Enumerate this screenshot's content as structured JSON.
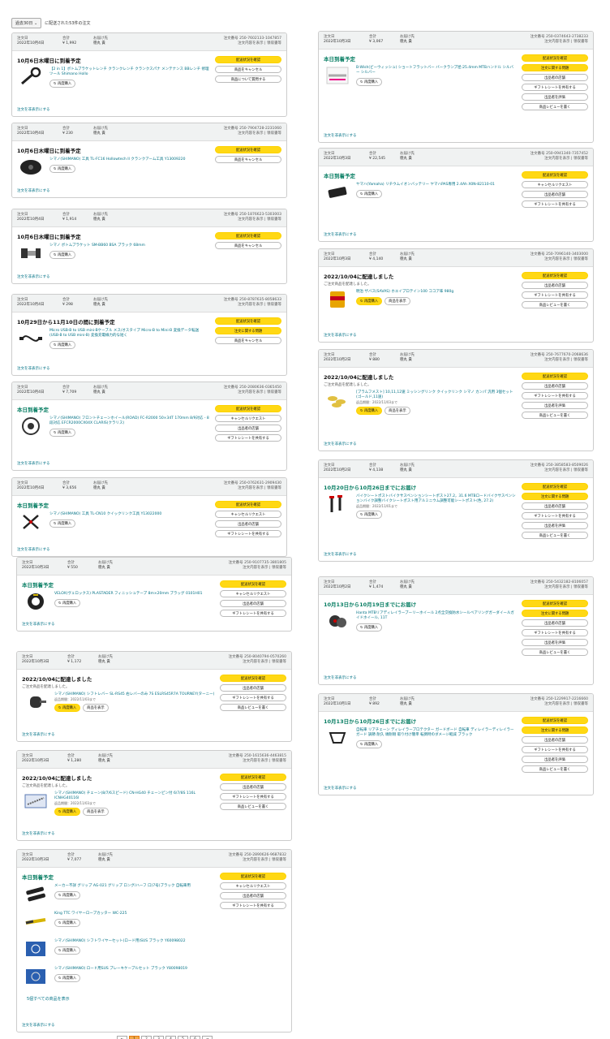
{
  "filter": {
    "selected": "過去30日",
    "summary": "に配送された53件の注文"
  },
  "labels": {
    "order_date": "注文日",
    "total": "合計",
    "ship_to": "お届け先",
    "order_no_prefix": "注文番号",
    "details": "注文内容を表示",
    "receipt": "領収書等",
    "hide": "注文を非表示にする",
    "rebuy": "再度購入",
    "view_item": "商品を表示",
    "show_all": "5個すべての商品を表示"
  },
  "orders": [
    {
      "date": "2022年10月4日",
      "total": "¥ 1,992",
      "to": "徳丸 貴",
      "no": "250-7602133-1047857",
      "status": "10月6日木曜日に到着予定",
      "sub": "",
      "items": [
        {
          "name": "【2 in 1】ボトムブラケットレンチ クランクレンチ クランクスパナ メンテナンス BBレンチ 修理ツール Shimano Hollo",
          "icon": "wrench-icon",
          "view": false
        }
      ],
      "actions": [
        "配送状況を確認",
        "商品をキャンセル",
        "商品について質問する"
      ]
    },
    {
      "date": "2022年10月4日",
      "total": "¥ 230",
      "to": "徳丸 貴",
      "no": "250-7904728-2231060",
      "status": "10月6日木曜日に到着予定",
      "sub": "",
      "items": [
        {
          "name": "シマノ(SHIMANO) 工具 TL-FC16 Hollowtech II クランクアーム工具 Y13009220",
          "icon": "crank-tool-icon",
          "view": false
        }
      ],
      "actions": [
        "配送状況を確認",
        "商品をキャンセル"
      ]
    },
    {
      "date": "2022年10月4日",
      "total": "¥ 1,914",
      "to": "徳丸 貴",
      "no": "250-1876623-5303003",
      "status": "10月6日木曜日に到着予定",
      "sub": "",
      "items": [
        {
          "name": "シマノ ボトムブラケット SM-BB60 BSA ブラック 68mm",
          "icon": "bottom-bracket-icon",
          "view": false
        }
      ],
      "actions": [
        "配送状況を確認",
        "商品をキャンセル"
      ]
    },
    {
      "date": "2022年10月4日",
      "total": "¥ 298",
      "to": "徳丸 貴",
      "no": "250-8787635-8058633",
      "status": "10月29日から11月10日の間に到着予定",
      "sub": "",
      "items": [
        {
          "name": "Micro USB-B to USB mini-Bケーブル メス/オスタイプ Micro-B to Mini-B 変換データ転送 (USB-B to USB mini-B) 変換充電線力的な短く",
          "icon": "cable-icon",
          "view": false
        }
      ],
      "actions": [
        "配送状況を確認",
        "注文に関する問題",
        "商品をキャンセル"
      ]
    },
    {
      "date": "2022年10月4日",
      "total": "¥ 7,709",
      "to": "徳丸 貴",
      "no": "250-2080636-0365450",
      "status": "本日到着予定",
      "green": true,
      "sub": "",
      "items": [
        {
          "name": "シマノ(SHIMANO) フロントチェーンホイール(ROAD) FC-R2000 50×34T 170mm 8/9対応 - 8段対応 EFCR2000CX04X CLARIS(クラリス)",
          "icon": "chainring-icon",
          "view": false
        }
      ],
      "actions": [
        "配送状況を確認",
        "キャンセルリクエスト",
        "出品者の店舗",
        "ギフトレシートを共有する"
      ]
    },
    {
      "date": "2022年10月4日",
      "total": "¥ 3,656",
      "to": "徳丸 貴",
      "no": "250-0762631-2909430",
      "status": "本日到着予定",
      "green": true,
      "sub": "",
      "items": [
        {
          "name": "シマノ(SHIMANO) 工具 TL-CN10 クイックリンク工具 Y13022000",
          "icon": "pliers-icon",
          "view": false
        }
      ],
      "actions": [
        "配送状況を確認",
        "キャンセルリクエスト",
        "出品者の店舗",
        "ギフトレシートを共有する"
      ]
    },
    {
      "date": "2022年10月3日",
      "total": "¥ 550",
      "to": "徳丸 貴",
      "no": "250-9107735-3801805",
      "status": "本日到着予定",
      "green": true,
      "sub": "",
      "items": [
        {
          "name": "VELOX(ヴェロックス) PLASTADER フィニッシュテープ 8m×20mm ブラッグ 0101H01",
          "icon": "tape-icon",
          "view": false
        }
      ],
      "actions": [
        "配送状況を確認",
        "キャンセルリクエスト",
        "出品者の店舗",
        "ギフトレシートを共有する"
      ]
    },
    {
      "date": "2022年10月3日",
      "total": "¥ 1,172",
      "to": "徳丸 貴",
      "no": "250-8040794-0570260",
      "status": "2022/10/04に配達しました",
      "sub": "ご注文商品を配達しました。",
      "items": [
        {
          "name": "シマノ(SHIMANO) シフトレバー SL-RS45 右レバーのみ 7S ESLRS45R7A TOURNEY(ターニー)",
          "icon": "shift-lever-icon",
          "view": true,
          "note": "返品期間：2022/11/03まで"
        }
      ],
      "actions": [
        "配送状況を確認",
        "出品者の店舗",
        "ギフトレシートを共有する",
        "商品レビューを書く"
      ]
    },
    {
      "date": "2022年10月3日",
      "total": "¥ 1,280",
      "to": "徳丸 貴",
      "no": "250-1615636-4463815",
      "status": "2022/10/04に配達しました",
      "sub": "ご注文商品を配達しました。",
      "items": [
        {
          "name": "シマノ(SHIMANO) チェーン(8/7/6スピード) CN-HG40 チェーンピン付 6/7/8S 116L ICNHG40116I",
          "icon": "chain-icon",
          "view": true,
          "note": "返品期間：2022/11/03まで"
        }
      ],
      "actions": [
        "配送状況を確認",
        "出品者の店舗",
        "ギフトレシートを共有する",
        "商品レビューを書く"
      ]
    },
    {
      "date": "2022年10月3日",
      "total": "¥ 7,077",
      "to": "徳丸 貴",
      "no": "250-2890626-9687832",
      "status": "本日到着予定",
      "green": true,
      "sub": "",
      "items": [
        {
          "name": "メーカー不詳 グリップ AG-021 グリップ ロング/ハーフ 口(7号)ブラック 自転車用",
          "icon": "grip-icon",
          "view": false
        },
        {
          "name": "King TTC ワイヤーロープカッター WC-225",
          "icon": "cutter-icon",
          "view": false
        },
        {
          "name": "シマノ(SHIMANO) シフトワイヤーセット(ロード用)SUS ブラック Y60098022",
          "icon": "cable-set-icon",
          "view": false
        },
        {
          "name": "シマノ(SHIMANO) ロード用SUS ブレーキケーブルセット ブラック Y80098019",
          "icon": "brake-cable-icon",
          "view": false
        }
      ],
      "more": true,
      "actions": [
        "配送状況を確認",
        "キャンセルリクエスト",
        "出品者の店舗",
        "ギフトレシートを共有する"
      ]
    },
    {
      "date": "2022年10月3日",
      "total": "¥ 3,067",
      "to": "徳丸 貴",
      "no": "250-0374643-2738233",
      "status": "本日到着予定",
      "green": true,
      "sub": "",
      "items": [
        {
          "name": "B-Wish(ビーウィッシュ) ショートフラットバー バークランプ径:25.4mm MTBハンドル シルバー シルバー",
          "icon": "bar-icon",
          "view": false
        }
      ],
      "actions": [
        "配送状況を確認",
        "注文に関する問題",
        "出品者の店舗",
        "ギフトレシートを共有する",
        "出品者を評価",
        "商品レビューを書く"
      ]
    },
    {
      "date": "2022年10月3日",
      "total": "¥ 22,545",
      "to": "徳丸 貴",
      "no": "250-0941340-7357452",
      "status": "本日到着予定",
      "green": true,
      "sub": "",
      "items": [
        {
          "name": "ヤマハ(Yamaha) リチウムイオンバッテリー ヤマハPAS専用 2.4Ah X0N-82110-01",
          "icon": "battery-icon",
          "view": false
        }
      ],
      "actions": [
        "配送状況を確認",
        "キャンセルリクエスト",
        "出品者の店舗",
        "ギフトレシートを共有する"
      ]
    },
    {
      "date": "2022年10月3日",
      "total": "¥ 4,140",
      "to": "徳丸 貴",
      "no": "250-7096140-3403000",
      "status": "2022/10/04に配達しました",
      "sub": "ご注文商品を配達しました。",
      "items": [
        {
          "name": "明治 ザバス(SAVAS) ホエイプロテイン100 ココア味 980g",
          "icon": "protein-icon",
          "view": true
        }
      ],
      "actions": [
        "配送状況を確認",
        "出品者の店舗",
        "ギフトレシートを共有する",
        "商品レビューを書く"
      ]
    },
    {
      "date": "2022年10月2日",
      "total": "¥ 880",
      "to": "徳丸 貴",
      "no": "250-7677670-2068636",
      "status": "2022/10/04に配達しました",
      "sub": "ご注文商品を配達しました。",
      "items": [
        {
          "name": "[ブラムフメスト] 10,11,12速 ミッシングリンク クイックリンク シマノ カンパ 汎用 3個セット (ゴールド,11速)",
          "icon": "links-icon",
          "view": true,
          "note": "返品期間：2022/11/03まで"
        }
      ],
      "actions": [
        "配送状況を確認",
        "出品者の店舗",
        "ギフトレシートを共有する",
        "出品者を評価",
        "商品レビューを書く"
      ]
    },
    {
      "date": "2022年10月2日",
      "total": "¥ 4,138",
      "to": "徳丸 貴",
      "no": "250-3858583-8509026",
      "status": "10月20日から10月26日までにお届け",
      "green": true,
      "sub": "",
      "items": [
        {
          "name": "バイクシートポストバイクサスペンションシートポスト27.2，31.6 MTBロードバイクサスペンションバイク調整バイクシートポスト用アルミニウム調整可能シートポスト(色, 27.2)",
          "icon": "seatpost-icon",
          "view": false,
          "note": "返品期間：2022/11/01まで"
        }
      ],
      "actions": [
        "配送状況を確認",
        "注文に関する問題",
        "出品者の店舗",
        "ギフトレシートを共有する",
        "出品者を評価",
        "商品レビューを書く"
      ]
    },
    {
      "date": "2022年10月2日",
      "total": "¥ 1,474",
      "to": "徳丸 貴",
      "no": "250-5432182-8106057",
      "status": "10月13日から10月19日までにお届け",
      "green": true,
      "sub": "",
      "items": [
        {
          "name": "Hanta MTBリアディレイラーブーリーホイール 2点全交換防水シールベアリングガーダイールガイドホイール, 11T",
          "icon": "pulley-icon",
          "view": false
        }
      ],
      "actions": [
        "配送状況を確認",
        "注文に関する問題",
        "出品者の店舗",
        "ギフトレシートを共有する",
        "出品者を評価",
        "商品レビューを書く"
      ]
    },
    {
      "date": "2022年10月1日",
      "total": "¥ 892",
      "to": "徳丸 貴",
      "no": "250-1229917-2216660",
      "status": "10月13日から10月26日までにお届け",
      "green": true,
      "sub": "",
      "items": [
        {
          "name": "自転車 リアチェーン ディレイラープロテクター ガードボード 自転車 ディレイラーディレイラーガード 調節 耐久 頑耐剛 取り付け簡単 転倒時のダメージ軽減 ブラック",
          "icon": "guard-icon",
          "view": false
        }
      ],
      "actions": [
        "配送状況を確認",
        "注文に関する問題",
        "出品者の店舗",
        "ギフトレシートを共有する",
        "出品者を評価",
        "商品レビューを書く"
      ]
    }
  ],
  "pager": [
    "←",
    "1",
    "2",
    "3",
    "4",
    "5",
    "6",
    "→"
  ]
}
